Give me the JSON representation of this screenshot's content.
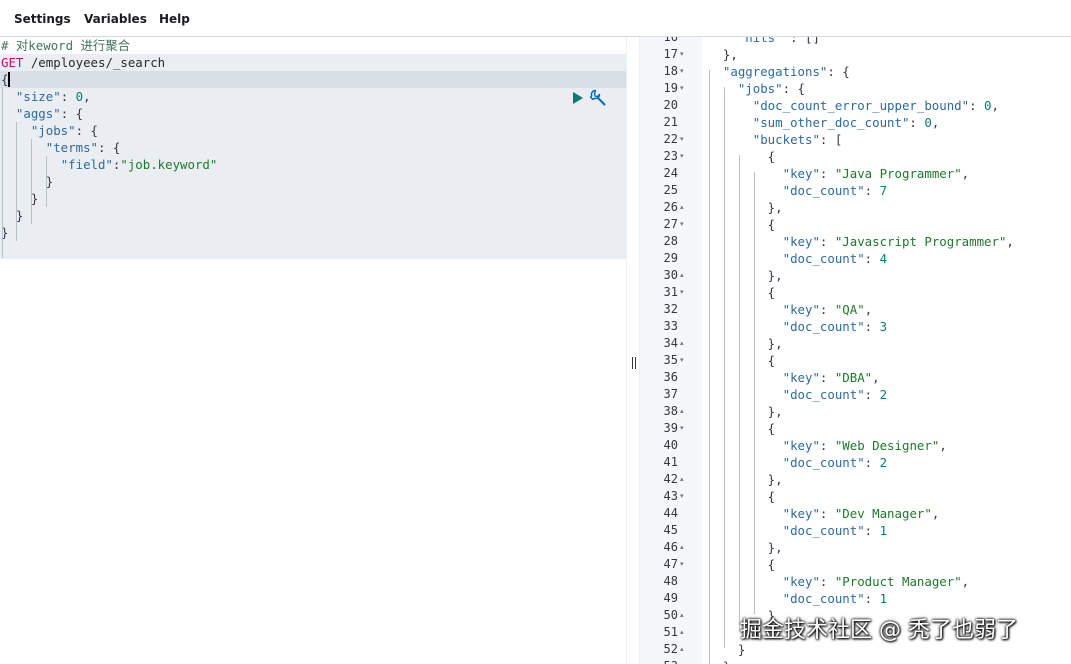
{
  "menu": {
    "settings": "Settings",
    "variables": "Variables",
    "help": "Help"
  },
  "request": {
    "lines": [
      [
        [
          "c-comment",
          "# 对keword 进行聚合"
        ]
      ],
      [
        [
          "c-method",
          "GET"
        ],
        [
          "c-url",
          " /employees/_search"
        ]
      ],
      [
        [
          "c-punc",
          "{"
        ]
      ],
      [
        [
          "c-punc",
          "  "
        ],
        [
          "c-key",
          "\"size\""
        ],
        [
          "c-punc",
          ": "
        ],
        [
          "c-num",
          "0"
        ],
        [
          "c-punc",
          ","
        ]
      ],
      [
        [
          "c-punc",
          "  "
        ],
        [
          "c-key",
          "\"aggs\""
        ],
        [
          "c-punc",
          ": {"
        ]
      ],
      [
        [
          "c-punc",
          "    "
        ],
        [
          "c-key",
          "\"jobs\""
        ],
        [
          "c-punc",
          ": {"
        ]
      ],
      [
        [
          "c-punc",
          "      "
        ],
        [
          "c-key",
          "\"terms\""
        ],
        [
          "c-punc",
          ": {"
        ]
      ],
      [
        [
          "c-punc",
          "        "
        ],
        [
          "c-key",
          "\"field\""
        ],
        [
          "c-punc",
          ":"
        ],
        [
          "c-str",
          "\"job.keyword\""
        ]
      ],
      [
        [
          "c-punc",
          "      }"
        ]
      ],
      [
        [
          "c-punc",
          "    }"
        ]
      ],
      [
        [
          "c-punc",
          "  }"
        ]
      ],
      [
        [
          "c-punc",
          "}"
        ]
      ]
    ]
  },
  "response": {
    "lines": [
      {
        "n": "16",
        "fold": "",
        "code": [
          [
            "c-punc",
            "    "
          ],
          [
            "c-key",
            "\"hits\""
          ],
          [
            "c-punc",
            " : []"
          ]
        ]
      },
      {
        "n": "17",
        "fold": "▾",
        "code": [
          [
            "c-punc",
            "  },"
          ]
        ]
      },
      {
        "n": "18",
        "fold": "▾",
        "code": [
          [
            "c-punc",
            "  "
          ],
          [
            "c-key",
            "\"aggregations\""
          ],
          [
            "c-punc",
            ": {"
          ]
        ]
      },
      {
        "n": "19",
        "fold": "▾",
        "code": [
          [
            "c-punc",
            "    "
          ],
          [
            "c-key",
            "\"jobs\""
          ],
          [
            "c-punc",
            ": {"
          ]
        ]
      },
      {
        "n": "20",
        "fold": "",
        "code": [
          [
            "c-punc",
            "      "
          ],
          [
            "c-key",
            "\"doc_count_error_upper_bound\""
          ],
          [
            "c-punc",
            ": "
          ],
          [
            "c-num",
            "0"
          ],
          [
            "c-punc",
            ","
          ]
        ]
      },
      {
        "n": "21",
        "fold": "",
        "code": [
          [
            "c-punc",
            "      "
          ],
          [
            "c-key",
            "\"sum_other_doc_count\""
          ],
          [
            "c-punc",
            ": "
          ],
          [
            "c-num",
            "0"
          ],
          [
            "c-punc",
            ","
          ]
        ]
      },
      {
        "n": "22",
        "fold": "▾",
        "code": [
          [
            "c-punc",
            "      "
          ],
          [
            "c-key",
            "\"buckets\""
          ],
          [
            "c-punc",
            ": ["
          ]
        ]
      },
      {
        "n": "23",
        "fold": "▾",
        "code": [
          [
            "c-punc",
            "        {"
          ]
        ]
      },
      {
        "n": "24",
        "fold": "",
        "code": [
          [
            "c-punc",
            "          "
          ],
          [
            "c-key",
            "\"key\""
          ],
          [
            "c-punc",
            ": "
          ],
          [
            "c-str",
            "\"Java Programmer\""
          ],
          [
            "c-punc",
            ","
          ]
        ]
      },
      {
        "n": "25",
        "fold": "",
        "code": [
          [
            "c-punc",
            "          "
          ],
          [
            "c-key",
            "\"doc_count\""
          ],
          [
            "c-punc",
            ": "
          ],
          [
            "c-num",
            "7"
          ]
        ]
      },
      {
        "n": "26",
        "fold": "▴",
        "code": [
          [
            "c-punc",
            "        },"
          ]
        ]
      },
      {
        "n": "27",
        "fold": "▾",
        "code": [
          [
            "c-punc",
            "        {"
          ]
        ]
      },
      {
        "n": "28",
        "fold": "",
        "code": [
          [
            "c-punc",
            "          "
          ],
          [
            "c-key",
            "\"key\""
          ],
          [
            "c-punc",
            ": "
          ],
          [
            "c-str",
            "\"Javascript Programmer\""
          ],
          [
            "c-punc",
            ","
          ]
        ]
      },
      {
        "n": "29",
        "fold": "",
        "code": [
          [
            "c-punc",
            "          "
          ],
          [
            "c-key",
            "\"doc_count\""
          ],
          [
            "c-punc",
            ": "
          ],
          [
            "c-num",
            "4"
          ]
        ]
      },
      {
        "n": "30",
        "fold": "▴",
        "code": [
          [
            "c-punc",
            "        },"
          ]
        ]
      },
      {
        "n": "31",
        "fold": "▾",
        "code": [
          [
            "c-punc",
            "        {"
          ]
        ]
      },
      {
        "n": "32",
        "fold": "",
        "code": [
          [
            "c-punc",
            "          "
          ],
          [
            "c-key",
            "\"key\""
          ],
          [
            "c-punc",
            ": "
          ],
          [
            "c-str",
            "\"QA\""
          ],
          [
            "c-punc",
            ","
          ]
        ]
      },
      {
        "n": "33",
        "fold": "",
        "code": [
          [
            "c-punc",
            "          "
          ],
          [
            "c-key",
            "\"doc_count\""
          ],
          [
            "c-punc",
            ": "
          ],
          [
            "c-num",
            "3"
          ]
        ]
      },
      {
        "n": "34",
        "fold": "▴",
        "code": [
          [
            "c-punc",
            "        },"
          ]
        ]
      },
      {
        "n": "35",
        "fold": "▾",
        "code": [
          [
            "c-punc",
            "        {"
          ]
        ]
      },
      {
        "n": "36",
        "fold": "",
        "code": [
          [
            "c-punc",
            "          "
          ],
          [
            "c-key",
            "\"key\""
          ],
          [
            "c-punc",
            ": "
          ],
          [
            "c-str",
            "\"DBA\""
          ],
          [
            "c-punc",
            ","
          ]
        ]
      },
      {
        "n": "37",
        "fold": "",
        "code": [
          [
            "c-punc",
            "          "
          ],
          [
            "c-key",
            "\"doc_count\""
          ],
          [
            "c-punc",
            ": "
          ],
          [
            "c-num",
            "2"
          ]
        ]
      },
      {
        "n": "38",
        "fold": "▴",
        "code": [
          [
            "c-punc",
            "        },"
          ]
        ]
      },
      {
        "n": "39",
        "fold": "▾",
        "code": [
          [
            "c-punc",
            "        {"
          ]
        ]
      },
      {
        "n": "40",
        "fold": "",
        "code": [
          [
            "c-punc",
            "          "
          ],
          [
            "c-key",
            "\"key\""
          ],
          [
            "c-punc",
            ": "
          ],
          [
            "c-str",
            "\"Web Designer\""
          ],
          [
            "c-punc",
            ","
          ]
        ]
      },
      {
        "n": "41",
        "fold": "",
        "code": [
          [
            "c-punc",
            "          "
          ],
          [
            "c-key",
            "\"doc_count\""
          ],
          [
            "c-punc",
            ": "
          ],
          [
            "c-num",
            "2"
          ]
        ]
      },
      {
        "n": "42",
        "fold": "▴",
        "code": [
          [
            "c-punc",
            "        },"
          ]
        ]
      },
      {
        "n": "43",
        "fold": "▾",
        "code": [
          [
            "c-punc",
            "        {"
          ]
        ]
      },
      {
        "n": "44",
        "fold": "",
        "code": [
          [
            "c-punc",
            "          "
          ],
          [
            "c-key",
            "\"key\""
          ],
          [
            "c-punc",
            ": "
          ],
          [
            "c-str",
            "\"Dev Manager\""
          ],
          [
            "c-punc",
            ","
          ]
        ]
      },
      {
        "n": "45",
        "fold": "",
        "code": [
          [
            "c-punc",
            "          "
          ],
          [
            "c-key",
            "\"doc_count\""
          ],
          [
            "c-punc",
            ": "
          ],
          [
            "c-num",
            "1"
          ]
        ]
      },
      {
        "n": "46",
        "fold": "▴",
        "code": [
          [
            "c-punc",
            "        },"
          ]
        ]
      },
      {
        "n": "47",
        "fold": "▾",
        "code": [
          [
            "c-punc",
            "        {"
          ]
        ]
      },
      {
        "n": "48",
        "fold": "",
        "code": [
          [
            "c-punc",
            "          "
          ],
          [
            "c-key",
            "\"key\""
          ],
          [
            "c-punc",
            ": "
          ],
          [
            "c-str",
            "\"Product Manager\""
          ],
          [
            "c-punc",
            ","
          ]
        ]
      },
      {
        "n": "49",
        "fold": "",
        "code": [
          [
            "c-punc",
            "          "
          ],
          [
            "c-key",
            "\"doc_count\""
          ],
          [
            "c-punc",
            ": "
          ],
          [
            "c-num",
            "1"
          ]
        ]
      },
      {
        "n": "50",
        "fold": "▴",
        "code": [
          [
            "c-punc",
            "        }"
          ]
        ]
      },
      {
        "n": "51",
        "fold": "▴",
        "code": [
          [
            "c-punc",
            "      ]"
          ]
        ]
      },
      {
        "n": "52",
        "fold": "▴",
        "code": [
          [
            "c-punc",
            "    }"
          ]
        ]
      },
      {
        "n": "53",
        "fold": "▴",
        "code": [
          [
            "c-punc",
            "  }"
          ]
        ]
      }
    ]
  },
  "icons": {
    "run": "play-icon",
    "settings": "wrench-icon"
  },
  "colors": {
    "run": "#017d73",
    "wrench": "#006bb8"
  },
  "watermark": "掘金技术社区 @ 秃了也弱了"
}
